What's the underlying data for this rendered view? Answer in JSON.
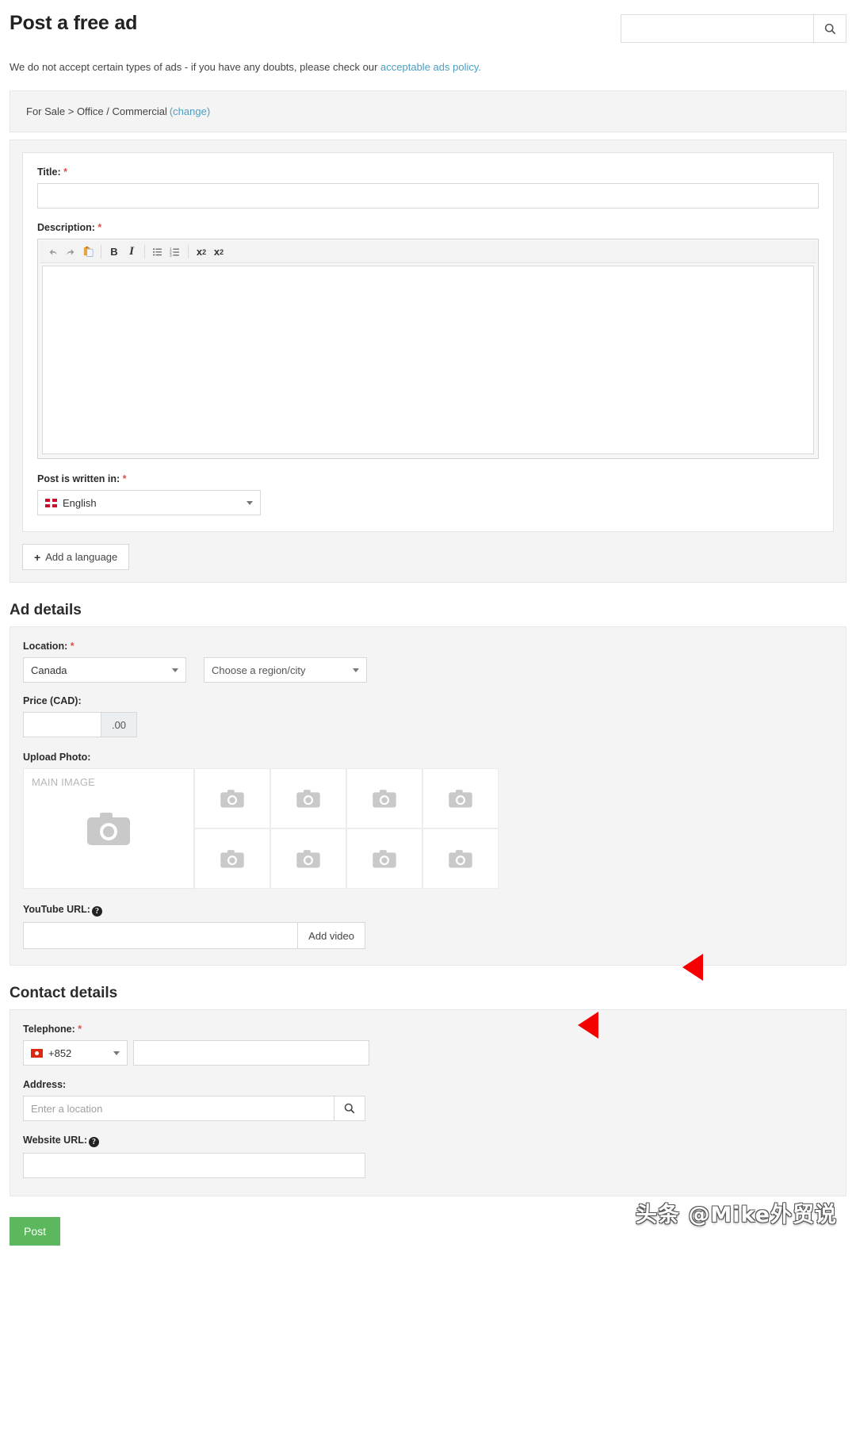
{
  "header": {
    "title": "Post a free ad",
    "search_placeholder": "",
    "search_value": "",
    "search_icon": "search-icon"
  },
  "notice": {
    "text_before": "We do not accept certain types of ads - if you have any doubts, please check our ",
    "link_text": "acceptable ads policy."
  },
  "breadcrumb": {
    "path": "For Sale > Office / Commercial",
    "change_label": "(change)"
  },
  "ad_form": {
    "title_label": "Title:",
    "title_value": "",
    "description_label": "Description:",
    "description_value": "",
    "required_marker": "*",
    "toolbar": [
      {
        "name": "undo-icon",
        "glyph": "↩"
      },
      {
        "name": "redo-icon",
        "glyph": "↪"
      },
      {
        "name": "paste-icon",
        "glyph": "📋"
      },
      {
        "name": "bold-icon",
        "glyph": "B"
      },
      {
        "name": "italic-icon",
        "glyph": "I"
      },
      {
        "name": "bullet-list-icon",
        "glyph": "☰"
      },
      {
        "name": "numbered-list-icon",
        "glyph": "☰"
      },
      {
        "name": "superscript-icon",
        "glyph": "x"
      },
      {
        "name": "subscript-icon",
        "glyph": "x"
      }
    ],
    "language_label": "Post is written in:",
    "language_value": "English",
    "add_language_label": "Add a language",
    "add_language_plus": "+"
  },
  "ad_details": {
    "section_title": "Ad details",
    "location_label": "Location:",
    "country_value": "Canada",
    "region_value": "Choose a region/city",
    "price_label": "Price (CAD):",
    "price_value": "",
    "price_suffix": ".00",
    "upload_label": "Upload Photo:",
    "main_image_label": "MAIN IMAGE",
    "thumb_count": 8,
    "youtube_label": "YouTube URL:",
    "youtube_value": "",
    "add_video_label": "Add video",
    "help_glyph": "?"
  },
  "contact_details": {
    "section_title": "Contact details",
    "telephone_label": "Telephone:",
    "dial_code": "+852",
    "telephone_value": "",
    "address_label": "Address:",
    "address_placeholder": "Enter a location",
    "address_value": "",
    "website_label": "Website URL:",
    "website_value": ""
  },
  "footer": {
    "post_label": "Post"
  },
  "watermark": {
    "text": "头条 @Mike外贸说"
  },
  "colors": {
    "accent_link": "#4a9fc2",
    "required": "#d9534f",
    "post_button": "#5cb85c",
    "arrow": "#f50000",
    "panel_bg": "#f4f4f4"
  }
}
